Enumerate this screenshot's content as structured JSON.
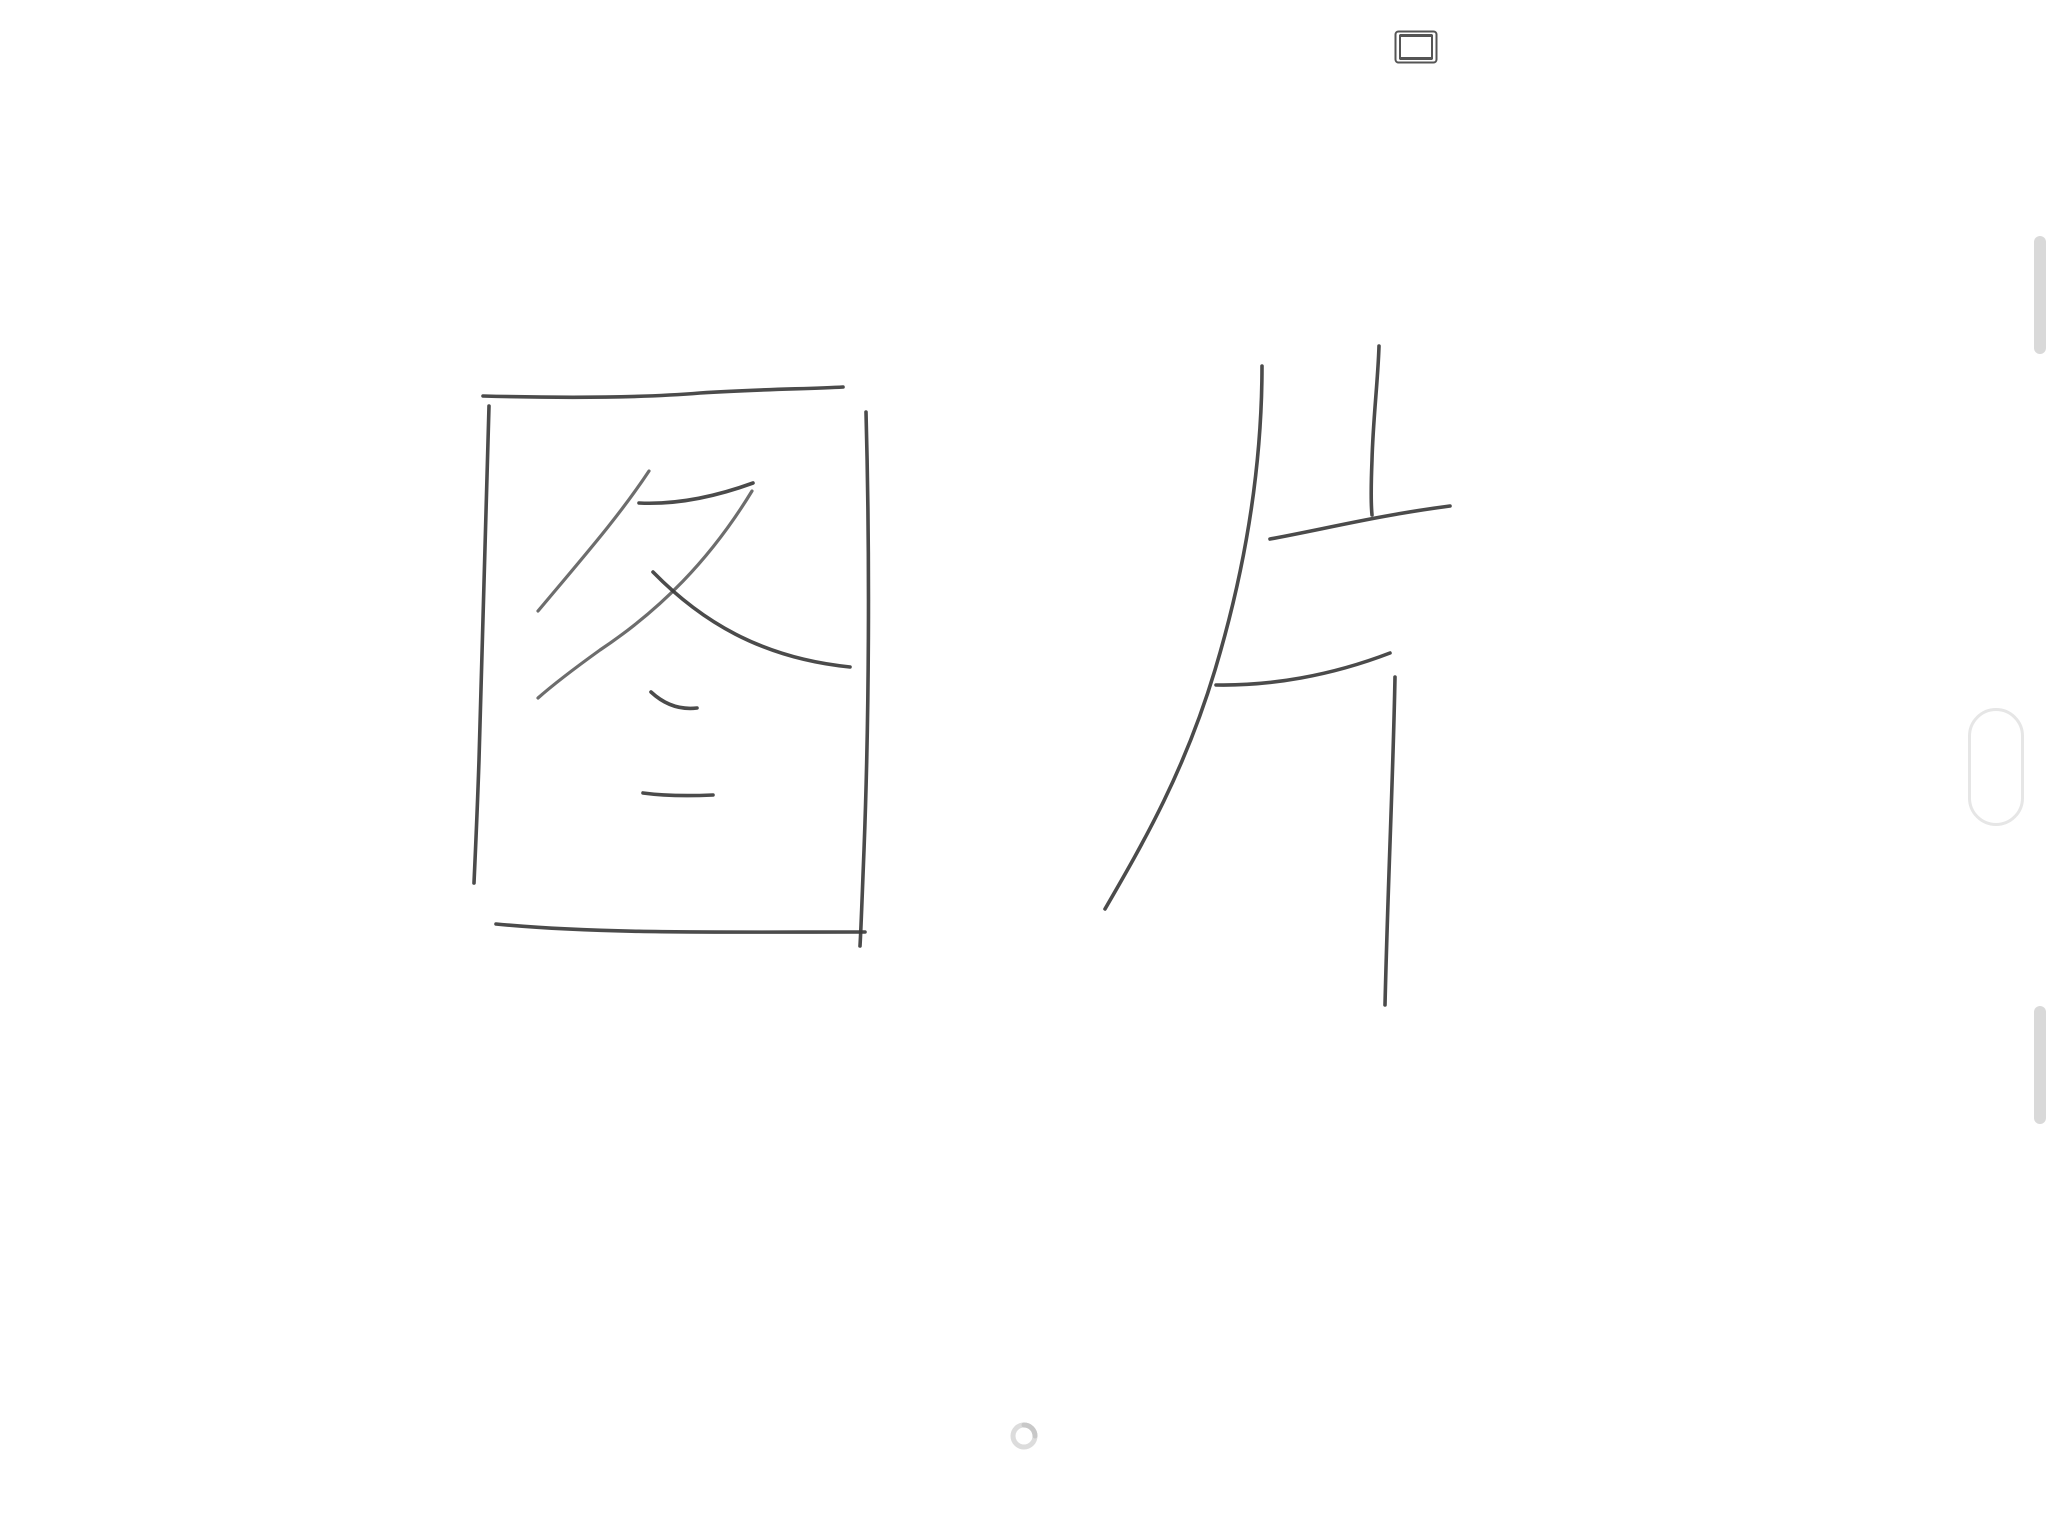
{
  "app": {
    "background_color": "#ffffff",
    "ink_color": "#3c3c3c"
  },
  "toolbar": {
    "fullscreen_icon": "fullscreen-frame-icon"
  },
  "canvas": {
    "handwritten_text": "图片",
    "characters": [
      "图",
      "片"
    ]
  },
  "side_controls": {
    "top_handle": "edge-handle",
    "bottom_handle": "edge-handle",
    "center_pill": "pill-handle"
  },
  "status": {
    "indicator_icon": "loading-spinner-icon"
  }
}
